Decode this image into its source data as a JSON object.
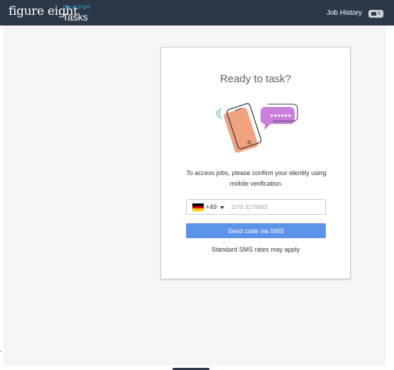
{
  "header": {
    "logo_text": "figure eight",
    "brand_small": "Figure Eight",
    "brand_title": "Tasks",
    "job_history_label": "Job History",
    "message_count": "0"
  },
  "card": {
    "title": "Ready to task?",
    "description": "To access jobs, please confirm your identity using mobile verification.",
    "country": {
      "flag": "germany-flag",
      "dial_code": "+49"
    },
    "phone_value": "1578 3279093",
    "send_button_label": "Send code via SMS",
    "rates_note": "Standard SMS rates may apply"
  },
  "colors": {
    "header_bg": "#2c3748",
    "button_bg": "#5b93e8",
    "phone_orange": "#f0a27f",
    "bubble_purple": "#c97fdb",
    "signal_green": "#4fb89a"
  },
  "icons": [
    "phone-illustration-icon",
    "chat-bubble-icon",
    "signal-waves-icon",
    "envelope-icon",
    "caret-down-icon"
  ]
}
